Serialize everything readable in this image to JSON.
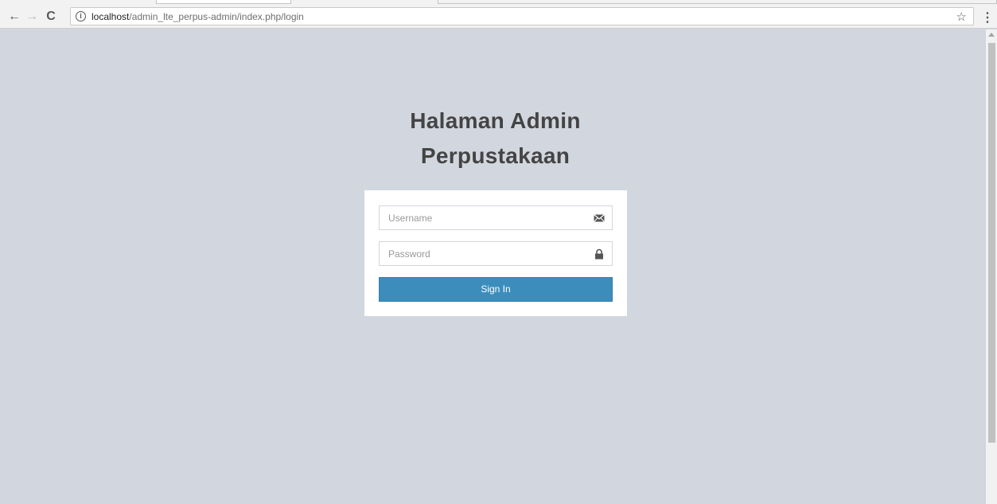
{
  "browser": {
    "url_host": "localhost",
    "url_path": "/admin_lte_perpus-admin/index.php/login",
    "info_glyph": "i",
    "star_glyph": "☆",
    "menu_glyph": "⋮",
    "back_glyph": "←",
    "forward_glyph": "→",
    "reload_glyph": "C"
  },
  "login": {
    "title_line1": "Halaman Admin",
    "title_line2": "Perpustakaan",
    "username_placeholder": "Username",
    "username_icon": "envelope-icon",
    "password_placeholder": "Password",
    "password_icon": "lock-icon",
    "submit_label": "Sign In"
  },
  "colors": {
    "background": "#d2d6de",
    "primary": "#3c8dbc",
    "title": "#444444"
  }
}
